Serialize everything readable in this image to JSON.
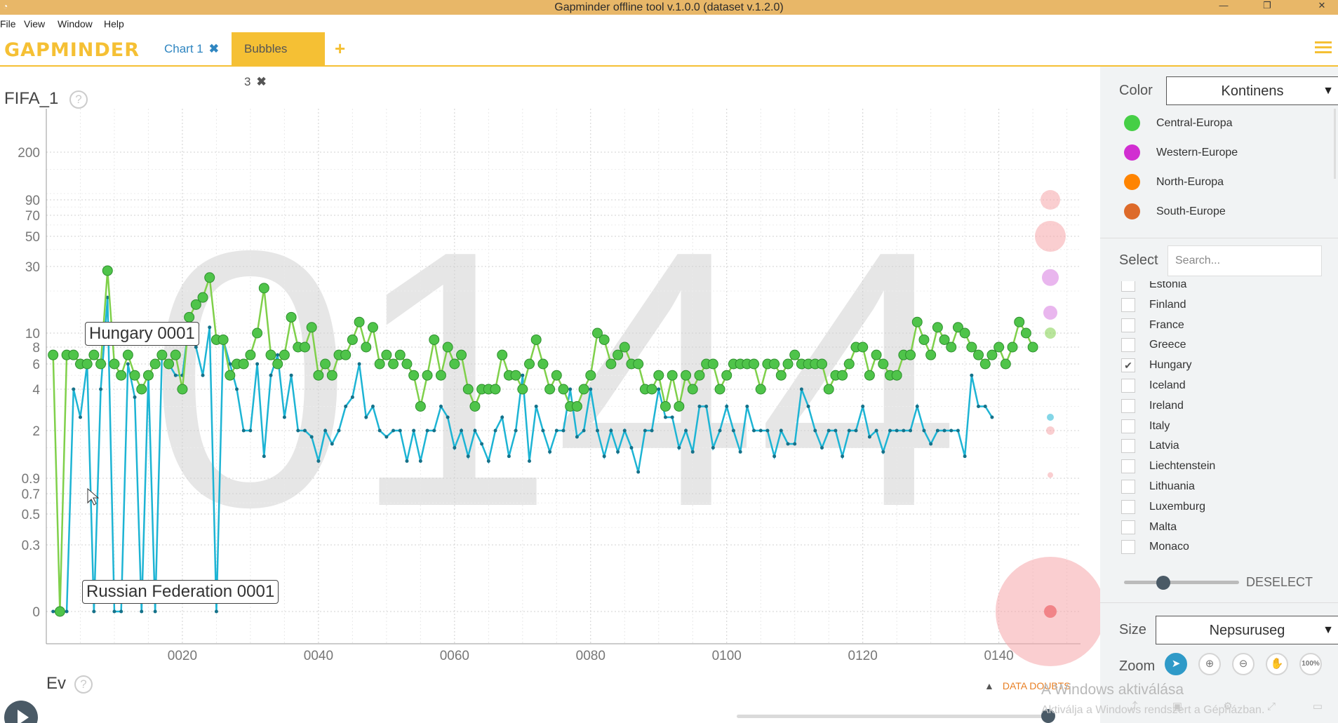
{
  "window": {
    "title": "Gapminder offline tool v.1.0.0 (dataset v.1.2.0)",
    "controls": [
      "—",
      "❐",
      "✕"
    ]
  },
  "menu": [
    "File",
    "View",
    "Window",
    "Help"
  ],
  "logo": "GAPMINDER",
  "tabs": [
    {
      "label": "Chart 1",
      "close": "✖"
    },
    {
      "label": "Bubbles 3",
      "close": "✖"
    }
  ],
  "add_tab": "+",
  "chart": {
    "y_title": "FIFA_1",
    "x_title": "Ev",
    "help": "?",
    "watermark": "0144",
    "data_doubts": "DATA DOUBTS",
    "labels": {
      "hungary": "Hungary 0001",
      "russia": "Russian Federation 0001"
    }
  },
  "chart_data": {
    "type": "line",
    "x_ticks": [
      "0020",
      "0040",
      "0060",
      "0080",
      "0100",
      "0120",
      "0140"
    ],
    "x_range": [
      0,
      152
    ],
    "y_ticks": [
      "200",
      "90",
      "70",
      "50",
      "30",
      "10",
      "8",
      "6",
      "4",
      "2",
      "0.9",
      "0.7",
      "0.5",
      "0.3",
      "0"
    ],
    "y_scale": "log",
    "grid": true,
    "series": [
      {
        "name": "Hungary",
        "color": "#7fd04a",
        "x_start": 1,
        "values": [
          7,
          0,
          7,
          7,
          6,
          6,
          7,
          6,
          28,
          6,
          5,
          7,
          5,
          4,
          5,
          6,
          7,
          6,
          7,
          4,
          13,
          16,
          18,
          25,
          9,
          9,
          5,
          6,
          6,
          7,
          10,
          21,
          7,
          6,
          7,
          13,
          8,
          8,
          11,
          5,
          6,
          5,
          7,
          7,
          9,
          12,
          8,
          11,
          6,
          7,
          6,
          7,
          6,
          5,
          3,
          5,
          9,
          5,
          8,
          6,
          7,
          4,
          3,
          4,
          4,
          4,
          7,
          5,
          5,
          4,
          6,
          9,
          6,
          4,
          5,
          4,
          3,
          3,
          4,
          5,
          10,
          9,
          6,
          7,
          8,
          6,
          6,
          4,
          4,
          5,
          3,
          5,
          3,
          5,
          4,
          5,
          6,
          6,
          4,
          5,
          6,
          6,
          6,
          6,
          4,
          6,
          6,
          5,
          6,
          7,
          6,
          6,
          6,
          6,
          4,
          5,
          5,
          6,
          8,
          8,
          5,
          7,
          6,
          5,
          5,
          7,
          7,
          12,
          9,
          7,
          11,
          9,
          8,
          11,
          10,
          8,
          7,
          6,
          7,
          8,
          6,
          8,
          12,
          10,
          8
        ],
        "marker": "circle"
      },
      {
        "name": "Russian Federation",
        "color": "#1db4d4",
        "x_start": 1,
        "values": [
          0,
          0,
          0,
          4,
          2.5,
          6,
          0,
          4,
          18,
          0,
          0,
          6,
          3.5,
          0,
          5,
          0,
          7,
          6,
          5,
          5,
          12,
          8,
          5,
          11,
          0,
          9,
          6,
          4,
          2,
          2,
          6,
          1.3,
          5,
          7,
          2.5,
          5,
          2,
          2,
          1.8,
          1.2,
          2,
          1.6,
          2,
          3,
          3.5,
          6,
          2.5,
          3,
          2,
          1.8,
          2,
          2,
          1.2,
          2,
          1.2,
          2,
          2,
          3,
          2.5,
          1.5,
          2,
          1.3,
          2,
          1.6,
          1.2,
          2,
          2.5,
          1.3,
          2,
          5,
          1.2,
          3,
          2,
          1.4,
          2,
          2,
          4,
          1.8,
          2,
          4,
          2,
          1.3,
          2,
          1.4,
          2,
          1.5,
          1,
          2,
          2,
          4,
          2.5,
          2.5,
          1.5,
          2,
          1.4,
          3,
          3,
          1.5,
          2,
          3,
          2,
          1.4,
          3,
          2,
          2,
          2,
          1.3,
          2,
          1.6,
          1.6,
          4,
          3,
          2,
          1.5,
          2,
          2,
          1.3,
          2,
          2,
          3,
          1.8,
          2,
          1.4,
          2,
          2,
          2,
          2,
          3,
          2,
          1.6,
          2,
          2,
          2,
          2,
          1.3,
          5,
          3,
          3,
          2.5
        ],
        "marker": "dot"
      }
    ],
    "bubbles_current_year": [
      {
        "y": 90,
        "color": "#f6a6aa",
        "r": 14
      },
      {
        "y": 50,
        "color": "#f6a6aa",
        "r": 22
      },
      {
        "y": 25,
        "color": "#d77ae0",
        "r": 12
      },
      {
        "y": 14,
        "color": "#d77ae0",
        "r": 10
      },
      {
        "y": 10,
        "color": "#7fd04a",
        "r": 8
      },
      {
        "y": 2.5,
        "color": "#1db4d4",
        "r": 5
      },
      {
        "y": 2,
        "color": "#f6a6aa",
        "r": 6
      },
      {
        "y": 0.95,
        "color": "#f6a6aa",
        "r": 4
      },
      {
        "y": 0,
        "color": "#f6a6aa",
        "r": 78
      }
    ]
  },
  "panel": {
    "color_label": "Color",
    "color_value": "Kontinens",
    "legend": [
      {
        "label": "Central-Europa",
        "color": "#46cf46"
      },
      {
        "label": "Western-Europe",
        "color": "#d12ed1"
      },
      {
        "label": "North-Europa",
        "color": "#ff8400"
      },
      {
        "label": "South-Europe",
        "color": "#dd6a2a"
      }
    ],
    "select_label": "Select",
    "search_placeholder": "Search...",
    "countries": [
      {
        "name": "Estonia",
        "checked": false
      },
      {
        "name": "Finland",
        "checked": false
      },
      {
        "name": "France",
        "checked": false
      },
      {
        "name": "Greece",
        "checked": false
      },
      {
        "name": "Hungary",
        "checked": true
      },
      {
        "name": "Iceland",
        "checked": false
      },
      {
        "name": "Ireland",
        "checked": false
      },
      {
        "name": "Italy",
        "checked": false
      },
      {
        "name": "Latvia",
        "checked": false
      },
      {
        "name": "Liechtenstein",
        "checked": false
      },
      {
        "name": "Lithuania",
        "checked": false
      },
      {
        "name": "Luxemburg",
        "checked": false
      },
      {
        "name": "Malta",
        "checked": false
      },
      {
        "name": "Monaco",
        "checked": false
      }
    ],
    "opacity": 0.3,
    "deselect": "DESELECT",
    "size_label": "Size",
    "size_value": "Nepsuruseg",
    "zoom_label": "Zoom",
    "zoom_100": "100%"
  },
  "windows_watermark": {
    "line1": "A Windows aktiválása",
    "line2": "Aktiválja a Windows rendszert a Gépházban."
  }
}
